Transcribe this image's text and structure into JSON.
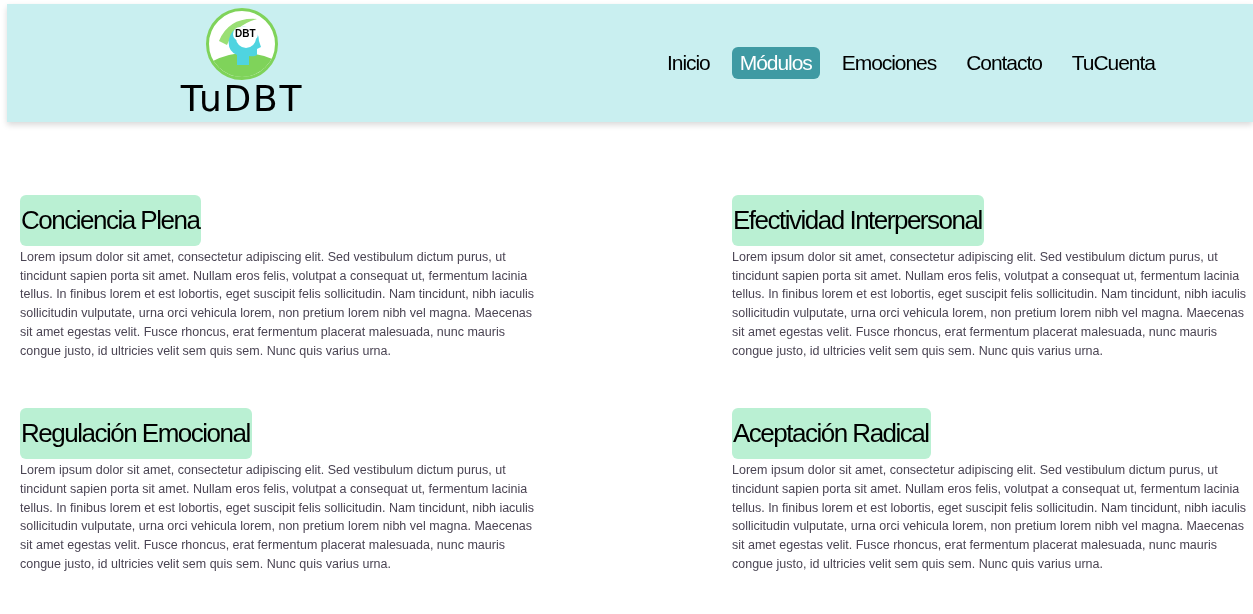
{
  "logo": {
    "badge": "DBT",
    "text": "TuDBT"
  },
  "nav": [
    {
      "label": "Inicio",
      "selected": false
    },
    {
      "label": "Módulos",
      "selected": true
    },
    {
      "label": "Emociones",
      "selected": false
    },
    {
      "label": "Contacto",
      "selected": false
    },
    {
      "label": "TuCuenta",
      "selected": false
    }
  ],
  "modules": [
    {
      "title": "Conciencia Plena",
      "body": "Lorem ipsum dolor sit amet, consectetur adipiscing elit. Sed vestibulum dictum purus, ut tincidunt sapien porta sit amet. Nullam eros felis, volutpat a consequat ut, fermentum lacinia tellus. In finibus lorem et est lobortis, eget suscipit felis sollicitudin. Nam tincidunt, nibh iaculis sollicitudin vulputate, urna orci vehicula lorem, non pretium lorem nibh vel magna. Maecenas sit amet egestas velit. Fusce rhoncus, erat fermentum placerat malesuada, nunc mauris congue justo, id ultricies velit sem quis sem. Nunc quis varius urna."
    },
    {
      "title": "Efectividad Interpersonal",
      "body": "Lorem ipsum dolor sit amet, consectetur adipiscing elit. Sed vestibulum dictum purus, ut tincidunt sapien porta sit amet. Nullam eros felis, volutpat a consequat ut, fermentum lacinia tellus. In finibus lorem et est lobortis, eget suscipit felis sollicitudin. Nam tincidunt, nibh iaculis sollicitudin vulputate, urna orci vehicula lorem, non pretium lorem nibh vel magna. Maecenas sit amet egestas velit. Fusce rhoncus, erat fermentum placerat malesuada, nunc mauris congue justo, id ultricies velit sem quis sem. Nunc quis varius urna."
    },
    {
      "title": "Regulación Emocional",
      "body": "Lorem ipsum dolor sit amet, consectetur adipiscing elit. Sed vestibulum dictum purus, ut tincidunt sapien porta sit amet. Nullam eros felis, volutpat a consequat ut, fermentum lacinia tellus. In finibus lorem et est lobortis, eget suscipit felis sollicitudin. Nam tincidunt, nibh iaculis sollicitudin vulputate, urna orci vehicula lorem, non pretium lorem nibh vel magna. Maecenas sit amet egestas velit. Fusce rhoncus, erat fermentum placerat malesuada, nunc mauris congue justo, id ultricies velit sem quis sem. Nunc quis varius urna."
    },
    {
      "title": "Aceptación Radical",
      "body": "Lorem ipsum dolor sit amet, consectetur adipiscing elit. Sed vestibulum dictum purus, ut tincidunt sapien porta sit amet. Nullam eros felis, volutpat a consequat ut, fermentum lacinia tellus. In finibus lorem et est lobortis, eget suscipit felis sollicitudin. Nam tincidunt, nibh iaculis sollicitudin vulputate, urna orci vehicula lorem, non pretium lorem nibh vel magna. Maecenas sit amet egestas velit. Fusce rhoncus, erat fermentum placerat malesuada, nunc mauris congue justo, id ultricies velit sem quis sem. Nunc quis varius urna."
    }
  ]
}
